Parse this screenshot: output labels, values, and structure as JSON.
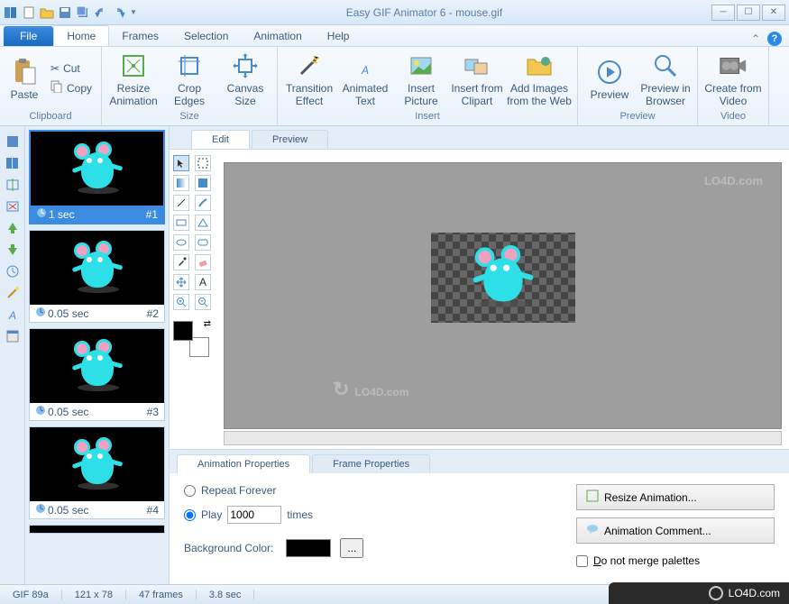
{
  "window": {
    "title": "Easy GIF Animator 6 - mouse.gif"
  },
  "menu": {
    "file": "File",
    "tabs": [
      "Home",
      "Frames",
      "Selection",
      "Animation",
      "Help"
    ]
  },
  "ribbon": {
    "clipboard": {
      "label": "Clipboard",
      "paste": "Paste",
      "cut": "Cut",
      "copy": "Copy"
    },
    "size": {
      "label": "Size",
      "resize": "Resize Animation",
      "crop": "Crop Edges",
      "canvas": "Canvas Size"
    },
    "insert": {
      "label": "Insert",
      "transition": "Transition Effect",
      "text": "Animated Text",
      "picture": "Insert Picture",
      "clipart": "Insert from Clipart",
      "web": "Add Images from the Web"
    },
    "preview": {
      "label": "Preview",
      "preview": "Preview",
      "browser": "Preview in Browser"
    },
    "video": {
      "label": "Video",
      "create": "Create from Video"
    }
  },
  "frames": [
    {
      "duration": "1 sec",
      "num": "#1",
      "selected": true
    },
    {
      "duration": "0.05 sec",
      "num": "#2",
      "selected": false
    },
    {
      "duration": "0.05 sec",
      "num": "#3",
      "selected": false
    },
    {
      "duration": "0.05 sec",
      "num": "#4",
      "selected": false
    }
  ],
  "edit_tabs": {
    "edit": "Edit",
    "preview": "Preview"
  },
  "watermark": "LO4D.com",
  "props": {
    "tabs": {
      "anim": "Animation Properties",
      "frame": "Frame Properties"
    },
    "repeat": "Repeat Forever",
    "play": "Play",
    "play_value": "1000",
    "times": "times",
    "bgcolor": "Background Color:",
    "resize_btn": "Resize Animation...",
    "comment_btn": "Animation Comment...",
    "merge": "Do not merge palettes"
  },
  "status": {
    "format": "GIF 89a",
    "dim": "121 x 78",
    "frames": "47 frames",
    "dur": "3.8 sec"
  }
}
